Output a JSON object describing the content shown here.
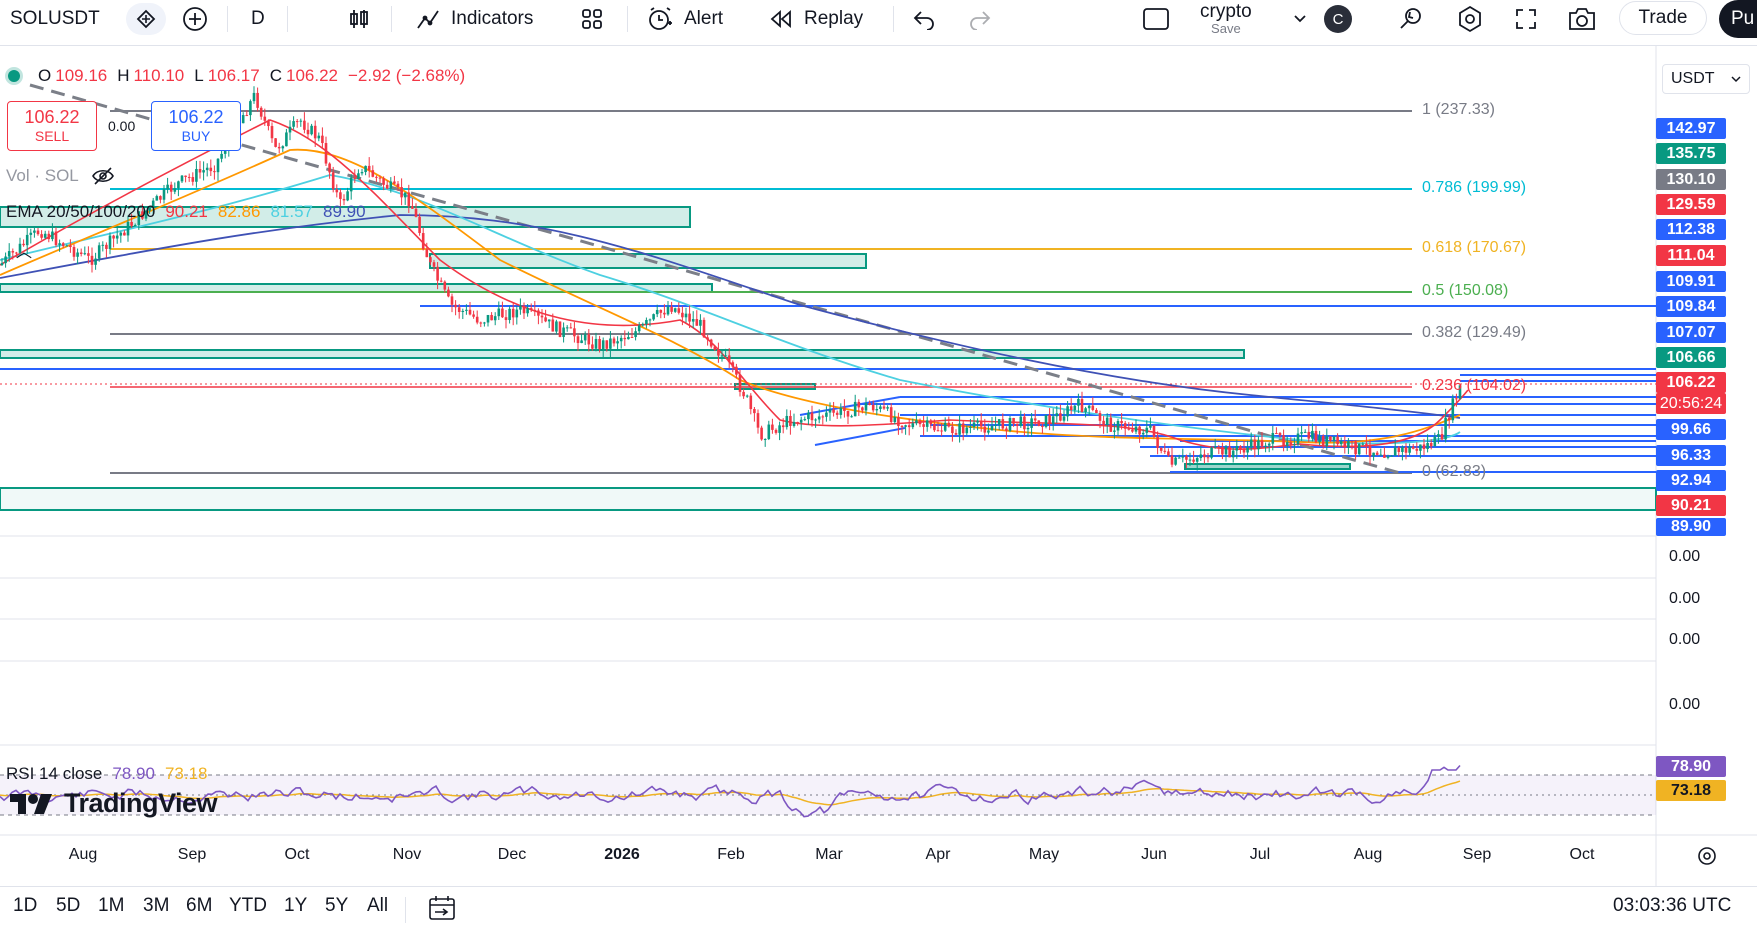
{
  "toolbar": {
    "symbol": "SOLUSDT",
    "interval": "D",
    "indicators_label": "Indicators",
    "alert_label": "Alert",
    "replay_label": "Replay",
    "layout_name": "crypto",
    "layout_save": "Save",
    "avatar_letter": "C",
    "trade_label": "Trade",
    "publish_label": "Pu"
  },
  "legend": {
    "o_label": "O",
    "o": "109.16",
    "h_label": "H",
    "h": "110.10",
    "l_label": "L",
    "l": "106.17",
    "c_label": "C",
    "c": "106.22",
    "change": "−2.92 (−2.68%)",
    "sell_price": "106.22",
    "sell_label": "SELL",
    "spread": "0.00",
    "buy_price": "106.22",
    "buy_label": "BUY",
    "vol_label": "Vol · SOL",
    "ema_label": "EMA 20/50/100/200",
    "ema20": "90.21",
    "ema50": "82.86",
    "ema100": "81.57",
    "ema200": "89.90"
  },
  "currency": "USDT",
  "fib_levels": [
    {
      "label": "1 (237.33)",
      "color": "#787b86"
    },
    {
      "label": "0.786 (199.99)",
      "color": "#00bcd4"
    },
    {
      "label": "0.618 (170.67)",
      "color": "#f0b323"
    },
    {
      "label": "0.5 (150.08)",
      "color": "#4caf50"
    },
    {
      "label": "0.382 (129.49)",
      "color": "#787b86"
    },
    {
      "label": "0.236 (104.02)",
      "color": "#f23645"
    },
    {
      "label": "0 (62.83)",
      "color": "#787b86"
    }
  ],
  "price_axis": [
    {
      "value": "142.97",
      "bg": "#2962ff"
    },
    {
      "value": "135.75",
      "bg": "#089981"
    },
    {
      "value": "130.10",
      "bg": "#787b86"
    },
    {
      "value": "129.59",
      "bg": "#f23645"
    },
    {
      "value": "112.38",
      "bg": "#2962ff"
    },
    {
      "value": "111.04",
      "bg": "#f23645"
    },
    {
      "value": "109.91",
      "bg": "#2962ff"
    },
    {
      "value": "109.84",
      "bg": "#2962ff"
    },
    {
      "value": "107.07",
      "bg": "#2962ff"
    },
    {
      "value": "106.66",
      "bg": "#089981"
    },
    {
      "value": "106.22",
      "bg": "#f23645"
    },
    {
      "value": "20:56:24",
      "bg": "#f23645"
    },
    {
      "value": "99.66",
      "bg": "#2962ff"
    },
    {
      "value": "96.33",
      "bg": "#2962ff"
    },
    {
      "value": "92.94",
      "bg": "#2962ff"
    },
    {
      "value": "90.21",
      "bg": "#f23645"
    },
    {
      "value": "89.90",
      "bg": "#2962ff"
    }
  ],
  "empty_panes": [
    "0.00",
    "0.00",
    "0.00",
    "0.00"
  ],
  "rsi": {
    "label": "RSI 14 close",
    "value": "78.90",
    "ma": "73.18"
  },
  "time_axis": [
    "Aug",
    "Sep",
    "Oct",
    "Nov",
    "Dec",
    "2026",
    "Feb",
    "Mar",
    "Apr",
    "May",
    "Jun",
    "Jul",
    "Aug",
    "Sep",
    "Oct"
  ],
  "logo": "TradingView",
  "ranges": [
    "1D",
    "5D",
    "1M",
    "3M",
    "6M",
    "YTD",
    "1Y",
    "5Y",
    "All"
  ],
  "clock": "03:03:36 UTC"
}
